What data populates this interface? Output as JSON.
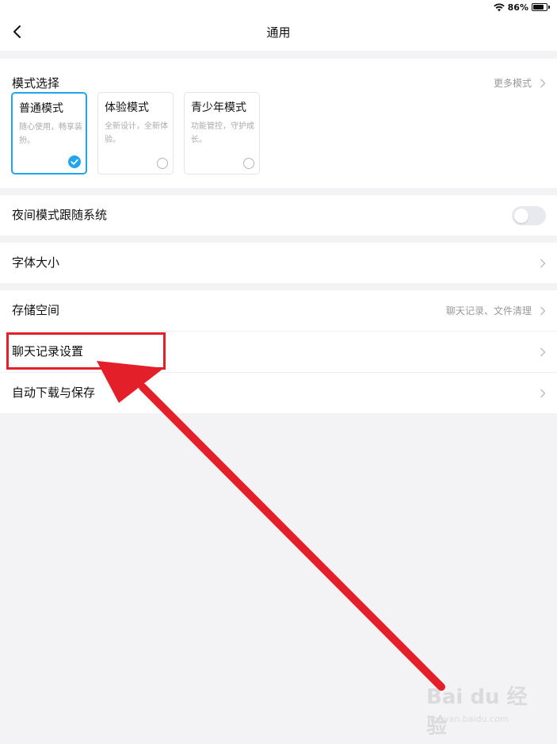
{
  "status_bar": {
    "wifi_icon": "wifi-icon",
    "battery_percent": "86%",
    "battery_level": 0.86
  },
  "nav": {
    "title": "通用",
    "back_icon": "chevron-left-icon"
  },
  "mode_section": {
    "title": "模式选择",
    "more_label": "更多模式",
    "modes": [
      {
        "name": "普通模式",
        "desc": "随心使用，畅享装扮。",
        "selected": true
      },
      {
        "name": "体验模式",
        "desc": "全新设计，全新体验。",
        "selected": false
      },
      {
        "name": "青少年模式",
        "desc": "功能管控，守护成长。",
        "selected": false
      }
    ]
  },
  "night_mode": {
    "label": "夜间模式跟随系统",
    "enabled": false
  },
  "font_size": {
    "label": "字体大小"
  },
  "storage": {
    "label": "存储空间",
    "value": "聊天记录、文件清理"
  },
  "chat_history": {
    "label": "聊天记录设置"
  },
  "auto_download": {
    "label": "自动下载与保存"
  },
  "annotation": {
    "box_color": "#e3202a",
    "arrow_color": "#e3202a"
  },
  "watermark": {
    "logo": "Bai du 经验",
    "sub": "jingyan.baidu.com"
  },
  "colors": {
    "accent": "#22a5ec",
    "background": "#f3f3f6"
  }
}
